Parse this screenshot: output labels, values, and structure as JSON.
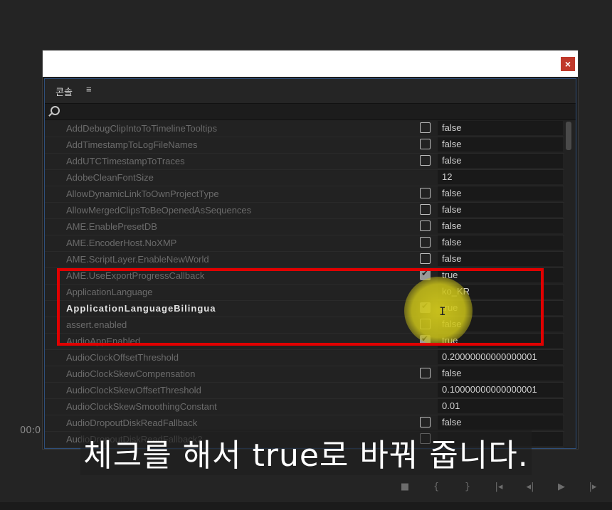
{
  "panel": {
    "title": "콘솔",
    "menu_icon": "hamburger-menu-icon"
  },
  "rows": [
    {
      "name": "AddDebugClipIntoToTimelineTooltips",
      "checkbox": true,
      "checked": false,
      "value": "false"
    },
    {
      "name": "AddTimestampToLogFileNames",
      "checkbox": true,
      "checked": false,
      "value": "false"
    },
    {
      "name": "AddUTCTimestampToTraces",
      "checkbox": true,
      "checked": false,
      "value": "false"
    },
    {
      "name": "AdobeCleanFontSize",
      "checkbox": false,
      "checked": false,
      "value": "12"
    },
    {
      "name": "AllowDynamicLinkToOwnProjectType",
      "checkbox": true,
      "checked": false,
      "value": "false"
    },
    {
      "name": "AllowMergedClipsToBeOpenedAsSequences",
      "checkbox": true,
      "checked": false,
      "value": "false"
    },
    {
      "name": "AME.EnablePresetDB",
      "checkbox": true,
      "checked": false,
      "value": "false"
    },
    {
      "name": "AME.EncoderHost.NoXMP",
      "checkbox": true,
      "checked": false,
      "value": "false"
    },
    {
      "name": "AME.ScriptLayer.EnableNewWorld",
      "checkbox": true,
      "checked": false,
      "value": "false"
    },
    {
      "name": "AME.UseExportProgressCallback",
      "checkbox": true,
      "checked": true,
      "value": "true"
    },
    {
      "name": "ApplicationLanguage",
      "checkbox": false,
      "checked": false,
      "value": "ko_KR"
    },
    {
      "name": "ApplicationLanguageBilingua",
      "checkbox": true,
      "checked": true,
      "value": "true",
      "bold": true
    },
    {
      "name": "assert.enabled",
      "checkbox": true,
      "checked": false,
      "value": "false"
    },
    {
      "name": "AudioAppEnabled",
      "checkbox": true,
      "checked": true,
      "value": "true"
    },
    {
      "name": "AudioClockOffsetThreshold",
      "checkbox": false,
      "checked": false,
      "value": "0.20000000000000001"
    },
    {
      "name": "AudioClockSkewCompensation",
      "checkbox": true,
      "checked": false,
      "value": "false"
    },
    {
      "name": "AudioClockSkewOffsetThreshold",
      "checkbox": false,
      "checked": false,
      "value": "0.10000000000000001"
    },
    {
      "name": "AudioClockSkewSmoothingConstant",
      "checkbox": false,
      "checked": false,
      "value": "0.01"
    },
    {
      "name": "AudioDropoutDiskReadFallback",
      "checkbox": true,
      "checked": false,
      "value": "false"
    },
    {
      "name": "AudioDropoutDiskReadFallback2",
      "checkbox": true,
      "checked": false,
      "value": ""
    }
  ],
  "subtitle": "체크를 해서 true로 바꿔 줍니다.",
  "timecode": "00:0",
  "colors": {
    "highlight": "#e10000",
    "cursor": "#d6cd1c",
    "dialog_border": "#2f4f7a"
  }
}
